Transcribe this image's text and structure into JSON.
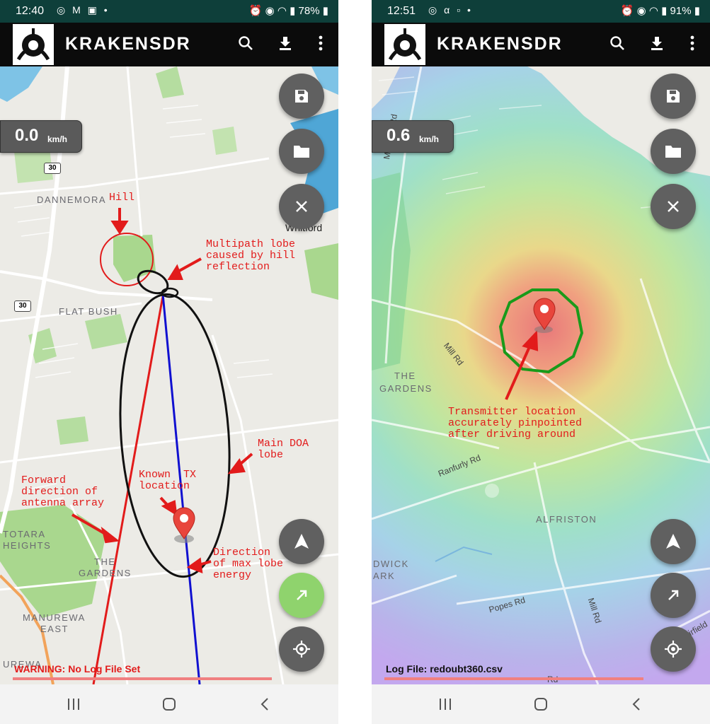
{
  "left": {
    "status": {
      "time": "12:40",
      "battery": "78%"
    },
    "app_title": "KRAKENSDR",
    "speed": {
      "value": "0.0",
      "unit": "km/h"
    },
    "log_text": "WARNING: No Log File Set",
    "map_labels": {
      "dannemora": "DANNEMORA",
      "whitford": "Whitford",
      "flat_bush": "FLAT BUSH",
      "totara": "TOTARA",
      "heights": "HEIGHTS",
      "the": "THE",
      "gardens": "GARDENS",
      "manurewa": "MANUREWA",
      "east": "EAST",
      "manurewa2": "UREWA",
      "route_30a": "30",
      "route_30b": "30"
    },
    "annotations": {
      "hill": "Hill",
      "multipath": "Multipath lobe\ncaused by hill\nreflection",
      "main_doa": "Main DOA\nlobe",
      "known_tx": "Known  TX\nlocation",
      "forward": "Forward\ndirection of\nantenna array",
      "direction": "Direction\nof max lobe\nenergy"
    }
  },
  "right": {
    "status": {
      "time": "12:51",
      "battery": "91%"
    },
    "app_title": "KRAKENSDR",
    "speed": {
      "value": "0.6",
      "unit": "km/h"
    },
    "log_text": "Log File: redoubt360.csv",
    "map_labels": {
      "murphys": "Murphys Rd",
      "mill_rd": "Mill Rd",
      "the": "THE",
      "gardens": "GARDENS",
      "ranfurly": "Ranfurly Rd",
      "alfriston": "ALFRISTON",
      "dwick": "DWICK",
      "ark": "ARK",
      "popes": "Popes Rd",
      "mill_rd2": "Mill Rd",
      "airfield": "Airfield",
      "rd": "Rd"
    },
    "annotations": {
      "transmitter": "Transmitter location\naccurately pinpointed\nafter driving around"
    }
  },
  "colors": {
    "status_bar": "#0e3f3a",
    "app_bar": "#0b0b0b",
    "fab": "#606060",
    "fab_active": "#8fd36d",
    "annotation": "#e21b1b",
    "warning_text": "#e21b1b"
  },
  "icons": [
    "search-icon",
    "download-icon",
    "more-vert-icon",
    "save-icon",
    "folder-icon",
    "close-icon",
    "navigation-icon",
    "arrow-ne-icon",
    "gps-fixed-icon",
    "recents-icon",
    "home-icon",
    "back-icon",
    "map-pin-icon"
  ]
}
